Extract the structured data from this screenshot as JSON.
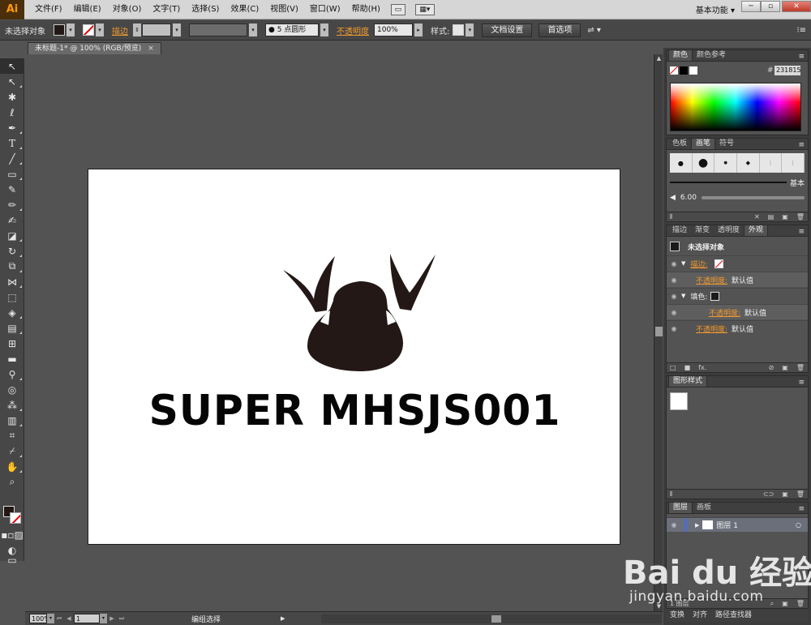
{
  "app": {
    "logo": "Ai",
    "workspace": "基本功能"
  },
  "menu": [
    "文件(F)",
    "编辑(E)",
    "对象(O)",
    "文字(T)",
    "选择(S)",
    "效果(C)",
    "视图(V)",
    "窗口(W)",
    "帮助(H)"
  ],
  "control_bar": {
    "selection": "未选择对象",
    "stroke_label": "描边",
    "brush": "5 点圆形",
    "opacity_label": "不透明度",
    "opacity_value": "100%",
    "style_label": "样式:",
    "doc_setup_button": "文档设置",
    "preferences_button": "首选项"
  },
  "document": {
    "tab_title": "未标题-1* @ 100% (RGB/预览)",
    "artwork_text": "SUPER MHSJS001",
    "logo_color": "#231815"
  },
  "status_bar": {
    "zoom": "100%",
    "artboard": "1",
    "status": "编组选择"
  },
  "color_panel": {
    "tabs": [
      "颜色",
      "颜色参考"
    ],
    "hex_label": "#",
    "hex_value": "231815"
  },
  "brush_panel": {
    "tabs": [
      "色板",
      "画笔",
      "符号"
    ],
    "basic_label": "基本",
    "size_label": "6.00"
  },
  "appearance_panel": {
    "tabs": [
      "描边",
      "渐变",
      "透明度",
      "外观"
    ],
    "title": "未选择对象",
    "rows": [
      {
        "label": "描边:",
        "value": ""
      },
      {
        "label": "不透明度:",
        "value": "默认值"
      },
      {
        "label": "填色:",
        "value": ""
      },
      {
        "label": "不透明度:",
        "value": "默认值"
      },
      {
        "label": "不透明度:",
        "value": "默认值"
      }
    ]
  },
  "graphic_styles_panel": {
    "tabs": [
      "图形样式"
    ]
  },
  "layers_panel": {
    "tabs": [
      "图层",
      "画板"
    ],
    "layer_name": "图层 1",
    "footer_label": "1 图层"
  },
  "bottom_tabs": [
    "变换",
    "对齐",
    "路径查找器"
  ],
  "watermark": {
    "brand": "Bai du 经验",
    "url": "jingyan.baidu.com"
  }
}
